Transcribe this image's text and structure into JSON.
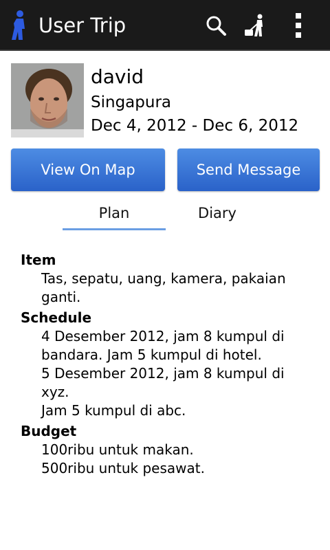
{
  "action_bar": {
    "title": "User Trip",
    "icons": [
      "walker-app-icon",
      "search-icon",
      "walking-luggage-icon",
      "overflow-menu-icon"
    ]
  },
  "profile": {
    "name": "david",
    "location": "Singapura",
    "date_range": "Dec 4, 2012 - Dec 6, 2012"
  },
  "buttons": {
    "view_on_map": "View On Map",
    "send_message": "Send Message"
  },
  "tabs": {
    "plan": "Plan",
    "diary": "Diary",
    "selected": "Plan"
  },
  "plan": {
    "item_title": "Item",
    "item_lines": [
      "Tas, sepatu, uang, kamera, pakaian",
      "ganti."
    ],
    "schedule_title": "Schedule",
    "schedule_lines": [
      "4 Desember 2012, jam 8 kumpul di",
      "bandara. Jam 5 kumpul di hotel.",
      "5 Desember 2012, jam 8 kumpul di xyz.",
      "Jam 5 kumpul di abc."
    ],
    "budget_title": "Budget",
    "budget_lines": [
      "100ribu untuk makan.",
      "500ribu untuk pesawat."
    ]
  },
  "colors": {
    "action_bar_bg": "#1a1a1a",
    "button_blue": "#3a75d6",
    "tab_indicator": "#6a9ee3"
  }
}
